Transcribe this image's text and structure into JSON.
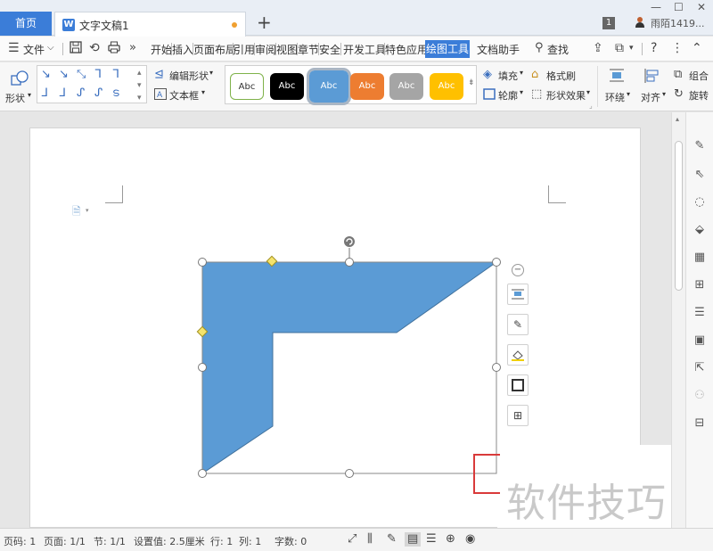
{
  "tabs": {
    "home": "首页",
    "doc_icon_letter": "W",
    "doc_title": "文字文稿1",
    "add_symbol": "+"
  },
  "window": {
    "minimize": "—",
    "maximize": "☐",
    "close": "✕",
    "badge_count": "1",
    "username": "雨陌1419..."
  },
  "menubar": {
    "file": "文件",
    "items": [
      "开始",
      "插入",
      "页面布局",
      "引用",
      "审阅",
      "视图",
      "章节",
      "安全",
      "开发工具",
      "特色应用"
    ],
    "active_tool": "绘图工具",
    "doc_assistant": "文档助手",
    "search": "查找"
  },
  "ribbon": {
    "shape": "形状",
    "edit_shape": "编辑形状",
    "textbox": "文本框",
    "styles": [
      "Abc",
      "Abc",
      "Abc",
      "Abc",
      "Abc",
      "Abc"
    ],
    "fill": "填充",
    "outline": "轮廓",
    "format_painter": "格式刷",
    "shape_effects": "形状效果",
    "wrap": "环绕",
    "align": "对齐",
    "group": "组合",
    "rotate": "旋转"
  },
  "colors": {
    "accent": "#3b7dd8",
    "shape_fill": "#5b9bd5",
    "style_white": "#ffffff",
    "style_black": "#000000",
    "style_blue": "#5b9bd5",
    "style_orange": "#ed7d31",
    "style_gray": "#a5a5a5",
    "style_yellow": "#ffc000"
  },
  "shape": {
    "type": "l-bracket-polygon"
  },
  "statusbar": {
    "page_num": "页码: 1",
    "page": "页面: 1/1",
    "section": "节: 1/1",
    "setting": "设置值: 2.5厘米",
    "row": "行: 1",
    "col": "列: 1",
    "word_count": "字数: 0"
  },
  "watermark": "软件技巧"
}
